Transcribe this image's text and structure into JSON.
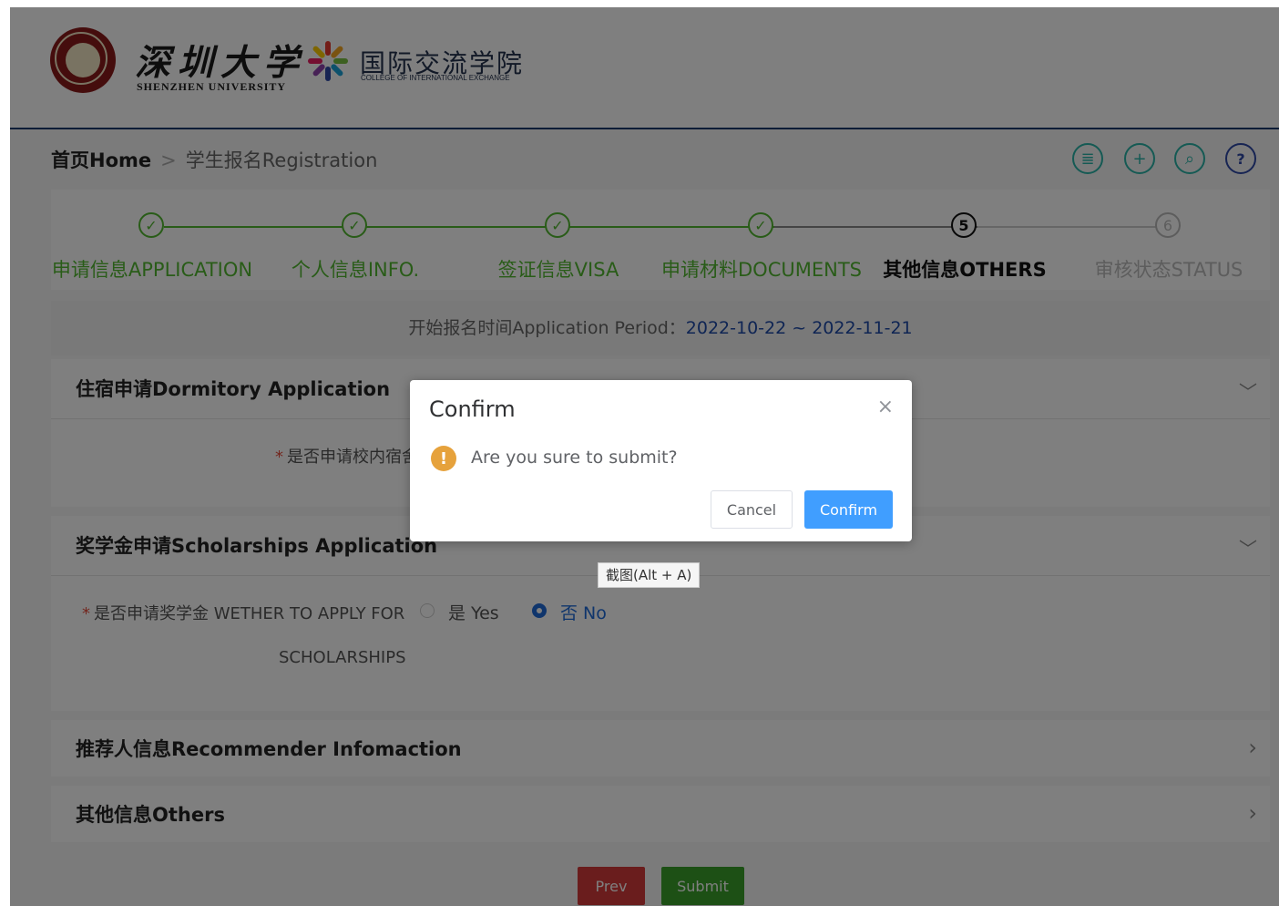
{
  "header": {
    "university_cn": "深圳大学",
    "university_en": "SHENZHEN UNIVERSITY",
    "college_cn": "国际交流学院",
    "college_en": "COLLEGE OF INTERNATIONAL EXCHANGE"
  },
  "breadcrumb": {
    "home": "首页Home",
    "separator": ">",
    "current": "学生报名Registration"
  },
  "toolbar": {
    "list_icon": "≣",
    "add_icon": "+",
    "search_icon": "⌕",
    "help_icon": "?"
  },
  "steps": [
    {
      "label": "申请信息APPLICATION",
      "marker": "✓",
      "state": "done"
    },
    {
      "label": "个人信息INFO.",
      "marker": "✓",
      "state": "done"
    },
    {
      "label": "签证信息VISA",
      "marker": "✓",
      "state": "done"
    },
    {
      "label": "申请材料DOCUMENTS",
      "marker": "✓",
      "state": "done"
    },
    {
      "label": "其他信息OTHERS",
      "marker": "5",
      "state": "active"
    },
    {
      "label": "审核状态STATUS",
      "marker": "6",
      "state": "pending"
    }
  ],
  "period": {
    "label": "开始报名时间Application Period：",
    "dates": "2022-10-22 ~ 2022-11-21"
  },
  "sections": {
    "dormitory": {
      "title": "住宿申请Dormitory Application",
      "field_label": "是否申请校内宿舍",
      "chevron": "﹀"
    },
    "scholarship": {
      "title": "奖学金申请Scholarships Application",
      "field_label_line1": "是否申请奖学金 WETHER TO APPLY FOR",
      "field_label_line2": "SCHOLARSHIPS",
      "option_yes": "是 Yes",
      "option_no": "否 No",
      "selected": "no",
      "chevron": "﹀"
    },
    "recommender": {
      "title": "推荐人信息Recommender Infomaction",
      "chevron": "›"
    },
    "others": {
      "title": "其他信息Others",
      "chevron": "›"
    }
  },
  "required_mark": "*",
  "buttons": {
    "prev": "Prev",
    "submit": "Submit"
  },
  "dialog": {
    "title": "Confirm",
    "close": "×",
    "warning_icon": "!",
    "message": "Are you sure to submit?",
    "cancel": "Cancel",
    "confirm": "Confirm"
  },
  "tooltip": "截图(Alt + A)",
  "colors": {
    "done": "#52b830",
    "active": "#111111",
    "pending": "#bbbbbb",
    "primary": "#409eff",
    "warning": "#e6a23c",
    "prev": "#d43a3a",
    "submit": "#3aa12a"
  }
}
